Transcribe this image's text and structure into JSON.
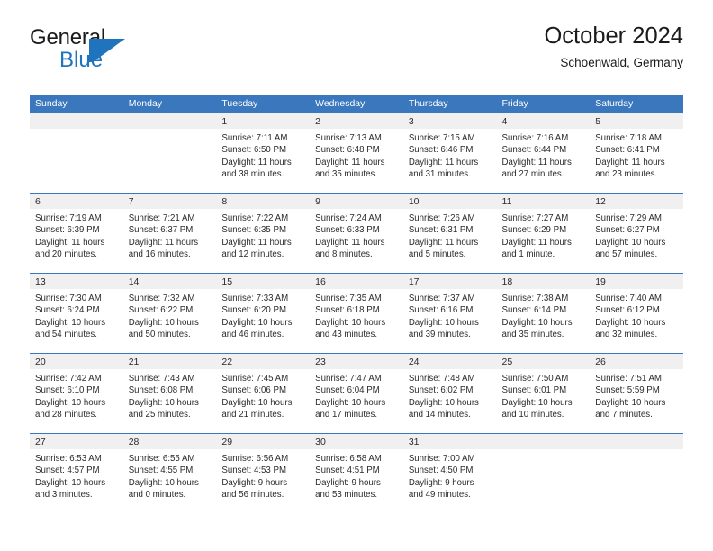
{
  "brand": {
    "name_line1": "General",
    "name_line2": "Blue",
    "mark_icon": "triangle-flag-icon",
    "accent_color": "#1f74bd"
  },
  "header": {
    "title": "October 2024",
    "subtitle": "Schoenwald, Germany"
  },
  "theme": {
    "header_blue": "#3a77bd",
    "date_band_gray": "#f0f0f0",
    "text": "#2b2b2b"
  },
  "weekday_headers": [
    "Sunday",
    "Monday",
    "Tuesday",
    "Wednesday",
    "Thursday",
    "Friday",
    "Saturday"
  ],
  "weeks": [
    [
      {
        "date": "",
        "sunrise": "",
        "sunset": "",
        "daylight_line1": "",
        "daylight_line2": ""
      },
      {
        "date": "",
        "sunrise": "",
        "sunset": "",
        "daylight_line1": "",
        "daylight_line2": ""
      },
      {
        "date": "1",
        "sunrise": "Sunrise: 7:11 AM",
        "sunset": "Sunset: 6:50 PM",
        "daylight_line1": "Daylight: 11 hours",
        "daylight_line2": "and 38 minutes."
      },
      {
        "date": "2",
        "sunrise": "Sunrise: 7:13 AM",
        "sunset": "Sunset: 6:48 PM",
        "daylight_line1": "Daylight: 11 hours",
        "daylight_line2": "and 35 minutes."
      },
      {
        "date": "3",
        "sunrise": "Sunrise: 7:15 AM",
        "sunset": "Sunset: 6:46 PM",
        "daylight_line1": "Daylight: 11 hours",
        "daylight_line2": "and 31 minutes."
      },
      {
        "date": "4",
        "sunrise": "Sunrise: 7:16 AM",
        "sunset": "Sunset: 6:44 PM",
        "daylight_line1": "Daylight: 11 hours",
        "daylight_line2": "and 27 minutes."
      },
      {
        "date": "5",
        "sunrise": "Sunrise: 7:18 AM",
        "sunset": "Sunset: 6:41 PM",
        "daylight_line1": "Daylight: 11 hours",
        "daylight_line2": "and 23 minutes."
      }
    ],
    [
      {
        "date": "6",
        "sunrise": "Sunrise: 7:19 AM",
        "sunset": "Sunset: 6:39 PM",
        "daylight_line1": "Daylight: 11 hours",
        "daylight_line2": "and 20 minutes."
      },
      {
        "date": "7",
        "sunrise": "Sunrise: 7:21 AM",
        "sunset": "Sunset: 6:37 PM",
        "daylight_line1": "Daylight: 11 hours",
        "daylight_line2": "and 16 minutes."
      },
      {
        "date": "8",
        "sunrise": "Sunrise: 7:22 AM",
        "sunset": "Sunset: 6:35 PM",
        "daylight_line1": "Daylight: 11 hours",
        "daylight_line2": "and 12 minutes."
      },
      {
        "date": "9",
        "sunrise": "Sunrise: 7:24 AM",
        "sunset": "Sunset: 6:33 PM",
        "daylight_line1": "Daylight: 11 hours",
        "daylight_line2": "and 8 minutes."
      },
      {
        "date": "10",
        "sunrise": "Sunrise: 7:26 AM",
        "sunset": "Sunset: 6:31 PM",
        "daylight_line1": "Daylight: 11 hours",
        "daylight_line2": "and 5 minutes."
      },
      {
        "date": "11",
        "sunrise": "Sunrise: 7:27 AM",
        "sunset": "Sunset: 6:29 PM",
        "daylight_line1": "Daylight: 11 hours",
        "daylight_line2": "and 1 minute."
      },
      {
        "date": "12",
        "sunrise": "Sunrise: 7:29 AM",
        "sunset": "Sunset: 6:27 PM",
        "daylight_line1": "Daylight: 10 hours",
        "daylight_line2": "and 57 minutes."
      }
    ],
    [
      {
        "date": "13",
        "sunrise": "Sunrise: 7:30 AM",
        "sunset": "Sunset: 6:24 PM",
        "daylight_line1": "Daylight: 10 hours",
        "daylight_line2": "and 54 minutes."
      },
      {
        "date": "14",
        "sunrise": "Sunrise: 7:32 AM",
        "sunset": "Sunset: 6:22 PM",
        "daylight_line1": "Daylight: 10 hours",
        "daylight_line2": "and 50 minutes."
      },
      {
        "date": "15",
        "sunrise": "Sunrise: 7:33 AM",
        "sunset": "Sunset: 6:20 PM",
        "daylight_line1": "Daylight: 10 hours",
        "daylight_line2": "and 46 minutes."
      },
      {
        "date": "16",
        "sunrise": "Sunrise: 7:35 AM",
        "sunset": "Sunset: 6:18 PM",
        "daylight_line1": "Daylight: 10 hours",
        "daylight_line2": "and 43 minutes."
      },
      {
        "date": "17",
        "sunrise": "Sunrise: 7:37 AM",
        "sunset": "Sunset: 6:16 PM",
        "daylight_line1": "Daylight: 10 hours",
        "daylight_line2": "and 39 minutes."
      },
      {
        "date": "18",
        "sunrise": "Sunrise: 7:38 AM",
        "sunset": "Sunset: 6:14 PM",
        "daylight_line1": "Daylight: 10 hours",
        "daylight_line2": "and 35 minutes."
      },
      {
        "date": "19",
        "sunrise": "Sunrise: 7:40 AM",
        "sunset": "Sunset: 6:12 PM",
        "daylight_line1": "Daylight: 10 hours",
        "daylight_line2": "and 32 minutes."
      }
    ],
    [
      {
        "date": "20",
        "sunrise": "Sunrise: 7:42 AM",
        "sunset": "Sunset: 6:10 PM",
        "daylight_line1": "Daylight: 10 hours",
        "daylight_line2": "and 28 minutes."
      },
      {
        "date": "21",
        "sunrise": "Sunrise: 7:43 AM",
        "sunset": "Sunset: 6:08 PM",
        "daylight_line1": "Daylight: 10 hours",
        "daylight_line2": "and 25 minutes."
      },
      {
        "date": "22",
        "sunrise": "Sunrise: 7:45 AM",
        "sunset": "Sunset: 6:06 PM",
        "daylight_line1": "Daylight: 10 hours",
        "daylight_line2": "and 21 minutes."
      },
      {
        "date": "23",
        "sunrise": "Sunrise: 7:47 AM",
        "sunset": "Sunset: 6:04 PM",
        "daylight_line1": "Daylight: 10 hours",
        "daylight_line2": "and 17 minutes."
      },
      {
        "date": "24",
        "sunrise": "Sunrise: 7:48 AM",
        "sunset": "Sunset: 6:02 PM",
        "daylight_line1": "Daylight: 10 hours",
        "daylight_line2": "and 14 minutes."
      },
      {
        "date": "25",
        "sunrise": "Sunrise: 7:50 AM",
        "sunset": "Sunset: 6:01 PM",
        "daylight_line1": "Daylight: 10 hours",
        "daylight_line2": "and 10 minutes."
      },
      {
        "date": "26",
        "sunrise": "Sunrise: 7:51 AM",
        "sunset": "Sunset: 5:59 PM",
        "daylight_line1": "Daylight: 10 hours",
        "daylight_line2": "and 7 minutes."
      }
    ],
    [
      {
        "date": "27",
        "sunrise": "Sunrise: 6:53 AM",
        "sunset": "Sunset: 4:57 PM",
        "daylight_line1": "Daylight: 10 hours",
        "daylight_line2": "and 3 minutes."
      },
      {
        "date": "28",
        "sunrise": "Sunrise: 6:55 AM",
        "sunset": "Sunset: 4:55 PM",
        "daylight_line1": "Daylight: 10 hours",
        "daylight_line2": "and 0 minutes."
      },
      {
        "date": "29",
        "sunrise": "Sunrise: 6:56 AM",
        "sunset": "Sunset: 4:53 PM",
        "daylight_line1": "Daylight: 9 hours",
        "daylight_line2": "and 56 minutes."
      },
      {
        "date": "30",
        "sunrise": "Sunrise: 6:58 AM",
        "sunset": "Sunset: 4:51 PM",
        "daylight_line1": "Daylight: 9 hours",
        "daylight_line2": "and 53 minutes."
      },
      {
        "date": "31",
        "sunrise": "Sunrise: 7:00 AM",
        "sunset": "Sunset: 4:50 PM",
        "daylight_line1": "Daylight: 9 hours",
        "daylight_line2": "and 49 minutes."
      },
      {
        "date": "",
        "sunrise": "",
        "sunset": "",
        "daylight_line1": "",
        "daylight_line2": ""
      },
      {
        "date": "",
        "sunrise": "",
        "sunset": "",
        "daylight_line1": "",
        "daylight_line2": ""
      }
    ]
  ]
}
